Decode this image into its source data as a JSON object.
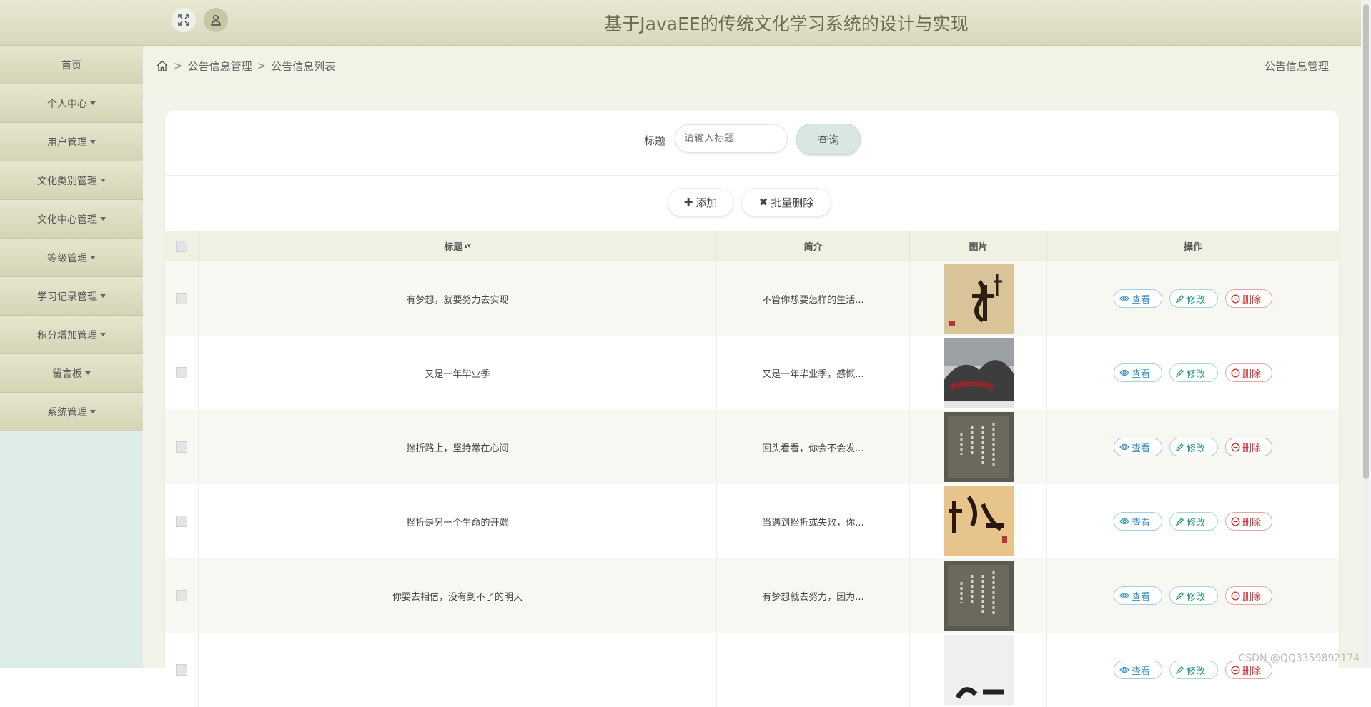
{
  "header": {
    "title": "基于JavaEE的传统文化学习系统的设计与实现"
  },
  "sidebar": {
    "items": [
      {
        "label": "首页",
        "dropdown": false
      },
      {
        "label": "个人中心",
        "dropdown": true
      },
      {
        "label": "用户管理",
        "dropdown": true
      },
      {
        "label": "文化类别管理",
        "dropdown": true
      },
      {
        "label": "文化中心管理",
        "dropdown": true
      },
      {
        "label": "等级管理",
        "dropdown": true
      },
      {
        "label": "学习记录管理",
        "dropdown": true
      },
      {
        "label": "积分增加管理",
        "dropdown": true
      },
      {
        "label": "留言板",
        "dropdown": true
      },
      {
        "label": "系统管理",
        "dropdown": true
      }
    ]
  },
  "breadcrumb": {
    "items": [
      "公告信息管理",
      "公告信息列表"
    ],
    "sep": ">",
    "right": "公告信息管理"
  },
  "search": {
    "label": "标题",
    "placeholder": "请输入标题",
    "button": "查询"
  },
  "actions": {
    "add": "添加",
    "batch_delete": "批量删除"
  },
  "table": {
    "headers": {
      "title": "标题",
      "intro": "简介",
      "image": "图片",
      "ops": "操作"
    },
    "ops": {
      "view": "查看",
      "edit": "修改",
      "delete": "删除"
    },
    "rows": [
      {
        "title": "有梦想，就要努力去实现",
        "intro": "不管你想要怎样的生活...",
        "image": "calligraphy-jing"
      },
      {
        "title": "又是一年毕业季",
        "intro": "又是一年毕业季，感慨...",
        "image": "ink-landscape"
      },
      {
        "title": "挫折路上，坚持常在心间",
        "intro": "回头看看，你会不会发...",
        "image": "calligraphy-scroll"
      },
      {
        "title": "挫折是另一个生命的开端",
        "intro": "当遇到挫折或失败，你...",
        "image": "calligraphy-shuhua"
      },
      {
        "title": "你要去相信，没有到不了的明天",
        "intro": "有梦想就去努力，因为...",
        "image": "calligraphy-scroll"
      },
      {
        "title": "",
        "intro": "",
        "image": "calligraphy-partial"
      }
    ]
  },
  "watermark": "CSDN @QQ3359892174",
  "colors": {
    "header_bg": "#dcdcc2",
    "sidebar_bg": "#deedea",
    "accent_blue": "#3b8fc0",
    "accent_green": "#25987a",
    "accent_red": "#c83333"
  }
}
